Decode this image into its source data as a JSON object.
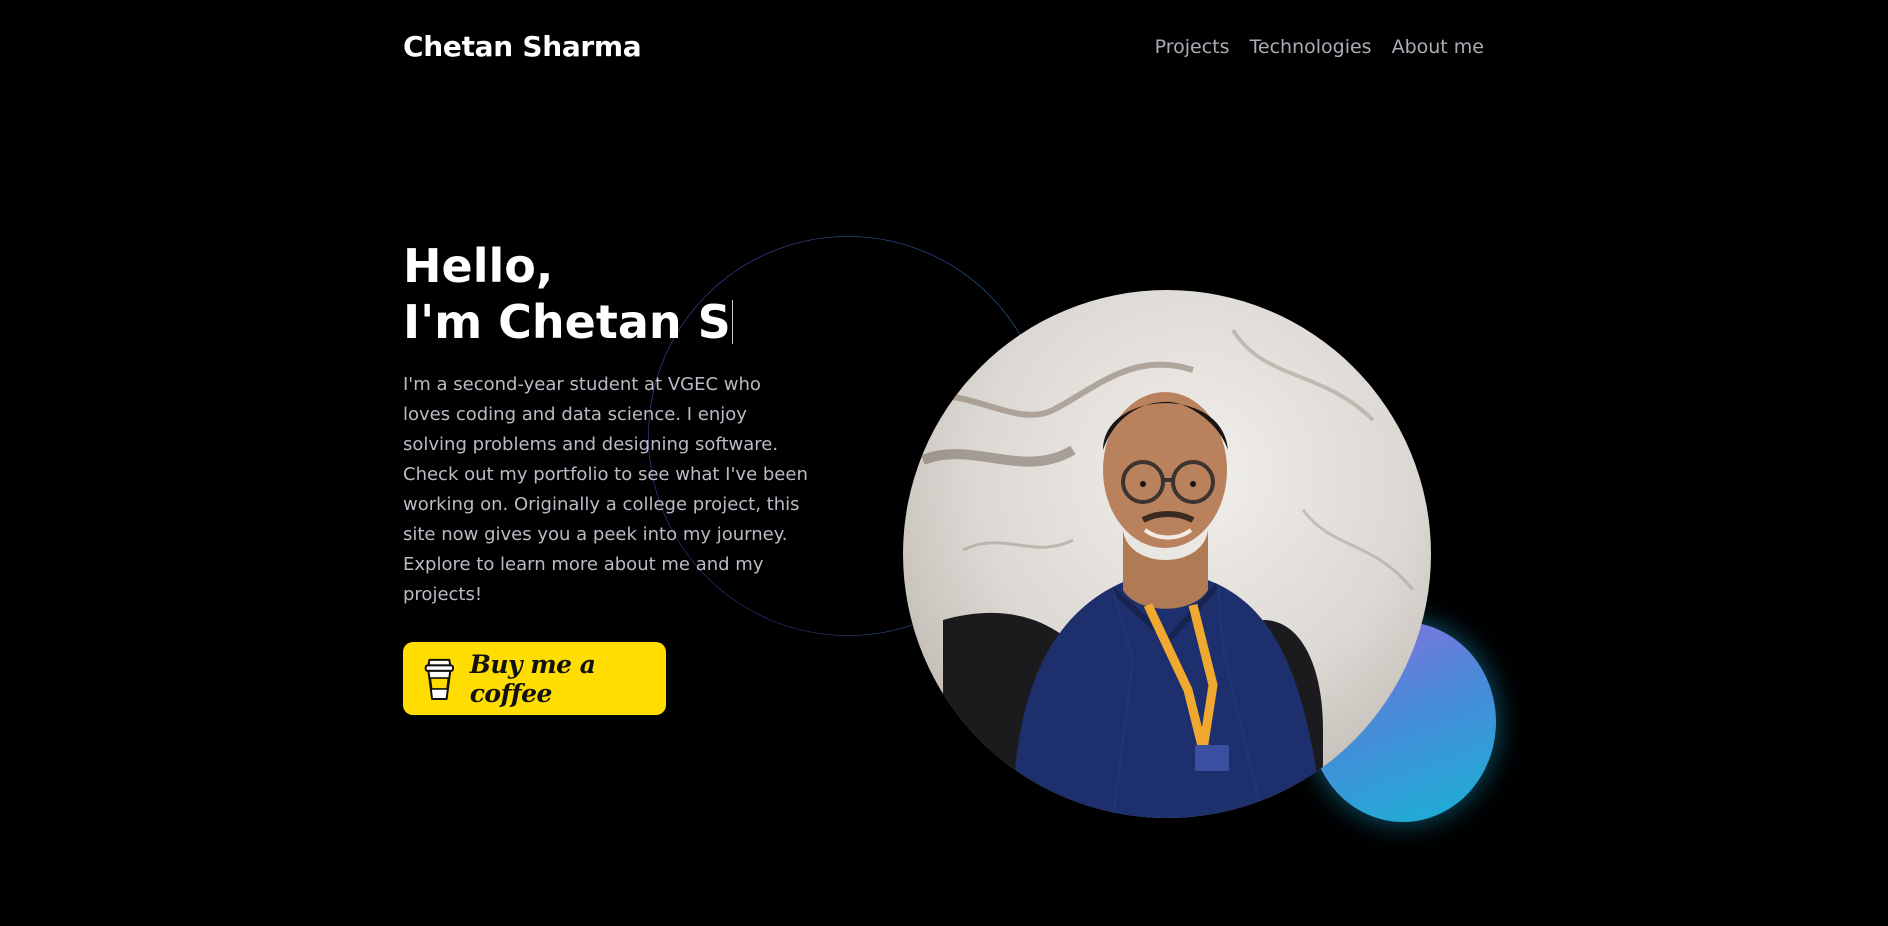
{
  "header": {
    "brand": "Chetan Sharma",
    "nav": [
      {
        "label": "Projects"
      },
      {
        "label": "Technologies"
      },
      {
        "label": "About me"
      }
    ]
  },
  "hero": {
    "greeting": "Hello,",
    "typing_text": "I'm Chetan S",
    "bio": "I'm a second-year student at VGEC who loves coding and data science. I enjoy solving problems and designing software. Check out my portfolio to see what I've been working on. Originally a college project, this site now gives you a peek into my journey. Explore to learn more about me and my projects!",
    "cta": {
      "label": "Buy me a coffee",
      "icon": "coffee-cup-icon",
      "color": "#ffdd00"
    }
  },
  "colors": {
    "background": "#000000",
    "text_primary": "#ffffff",
    "text_secondary": "#b8bcc4",
    "accent_gradient_start": "#8a6ee0",
    "accent_gradient_end": "#18b2d6"
  }
}
